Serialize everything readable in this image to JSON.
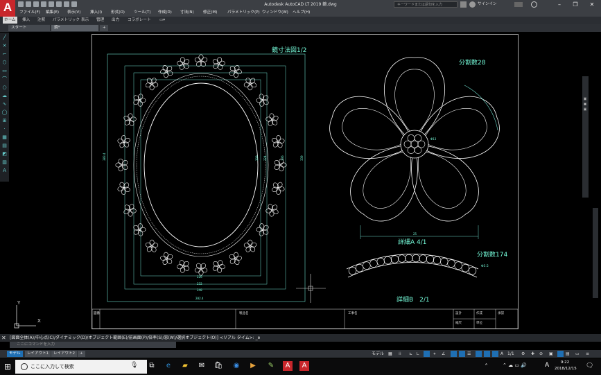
{
  "window": {
    "title": "Autodesk AutoCAD LT 2019   鏡.dwg",
    "logo": "A",
    "search_placeholder": "キーワードまたは語句を入力",
    "sign_in": "サインイン",
    "minimize": "–",
    "maximize": "❐",
    "close": "✕"
  },
  "menu": [
    "ファイル(F)",
    "編集(E)",
    "表示(V)",
    "挿入(I)",
    "形式(O)",
    "ツール(T)",
    "作成(D)",
    "寸法(N)",
    "修正(M)",
    "パラメトリック(P)",
    "ウィンドウ(W)",
    "ヘルプ(H)"
  ],
  "ribbon_tabs": [
    "ホーム",
    "挿入",
    "注釈",
    "パラメトリック",
    "表示",
    "管理",
    "出力",
    "コラボレート"
  ],
  "file_tabs": {
    "start": "スタート",
    "current": "鏡*",
    "add": "+"
  },
  "drawing": {
    "title_main": "鏡寸法図1/2",
    "divisions_28": "分割数28",
    "divisions_174": "分割数174",
    "detail_a": "詳細A 4/1",
    "detail_b": "詳細B　2/1",
    "dims_bottom": [
      "226",
      "232",
      "248",
      "282.4"
    ],
    "dims_right": [
      "309",
      "324",
      "336",
      "339"
    ],
    "dim_left": "383.4",
    "dim_flower": "Φ13",
    "dim_bead": "Φ3.5",
    "dim_a_bottom": "25"
  },
  "title_block": {
    "col1": "図番",
    "col2": "製品名",
    "col3": "工事名",
    "col4": "設計",
    "col5": "作成",
    "col6": "承認",
    "col7": "縮尺",
    "col8": "単位"
  },
  "command": {
    "history": "[図面全体(A)/中心点(C)/ダイナミック(D)/オブジェクト範囲(E)/前画面(P)/倍率(S)/窓(W)/選択オブジェクト(O)] <リアル タイム>: _e",
    "placeholder": "ここにコマンドを入力"
  },
  "layout_tabs": [
    "モデル",
    "レイアウト1",
    "レイアウト2",
    "+"
  ],
  "status": {
    "model_label": "モデル",
    "scale": "1/1"
  },
  "taskbar": {
    "search_placeholder": "ここに入力して検索",
    "time": "9:22",
    "date": "2018/12/15",
    "ime": "A"
  },
  "ucs": {
    "x": "X",
    "y": "Y"
  }
}
